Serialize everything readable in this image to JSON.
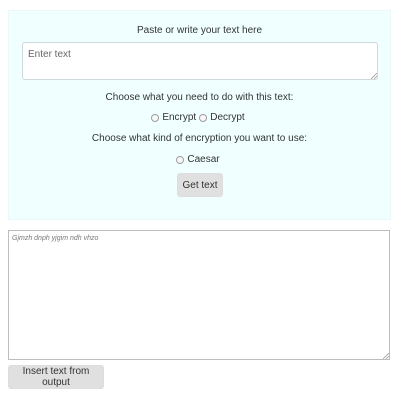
{
  "input_section": {
    "prompt": "Paste or write your text here",
    "input_placeholder": "Enter text",
    "action_prompt": "Choose what you need to do with this text:",
    "actions": [
      {
        "label": "Encrypt",
        "selected": false
      },
      {
        "label": "Decrypt",
        "selected": false
      }
    ],
    "encryption_prompt": "Choose what kind of encryption you want to use:",
    "encryption_types": [
      {
        "label": "Caesar",
        "selected": false
      }
    ],
    "submit_label": "Get text"
  },
  "output_section": {
    "placeholder": "Gjmzh dnph yjgim ndh vhzo",
    "insert_label": "Insert text from output"
  },
  "colors": {
    "panel_background": "#f0ffff",
    "button_background": "#e0e0e0",
    "text": "#333333"
  }
}
